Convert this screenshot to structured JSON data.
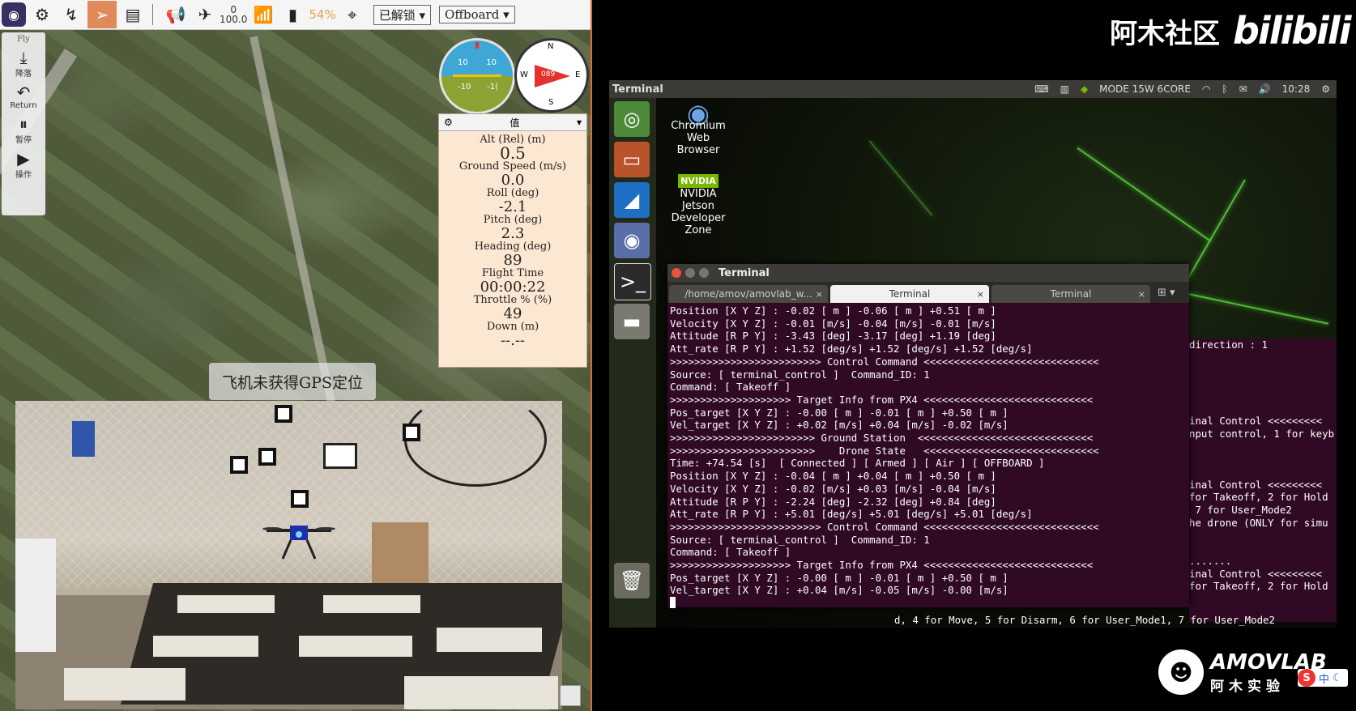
{
  "toolbar": {
    "counter_top": "0",
    "counter_bottom": "100.0",
    "battery": "54%",
    "arm_state": "已解锁",
    "flight_mode": "Offboard"
  },
  "fly_tools": {
    "heading": "Fly",
    "items": [
      {
        "label": "降落",
        "icon": "land-icon"
      },
      {
        "label": "Return",
        "icon": "return-icon"
      },
      {
        "label": "暂停",
        "icon": "pause-icon"
      },
      {
        "label": "操作",
        "icon": "action-icon"
      }
    ]
  },
  "attitude": {
    "pitch_top": "10",
    "pitch_top2": "10",
    "pitch_bottom": "-10",
    "pitch_bottom2": "-1("
  },
  "compass": {
    "n": "N",
    "e": "E",
    "s": "S",
    "w": "W",
    "heading": "089"
  },
  "values_panel": {
    "header": "值",
    "items": [
      {
        "label": "Alt (Rel) (m)",
        "value": "0.5"
      },
      {
        "label": "Ground Speed (m/s)",
        "value": "0.0"
      },
      {
        "label": "Roll (deg)",
        "value": "-2.1"
      },
      {
        "label": "Pitch (deg)",
        "value": "2.3"
      },
      {
        "label": "Heading (deg)",
        "value": "89"
      },
      {
        "label": "Flight Time",
        "value": "00:00:22"
      },
      {
        "label": "Throttle % (%)",
        "value": "49"
      },
      {
        "label": "Down (m)",
        "value": "--.--"
      }
    ]
  },
  "gps_message": "飞机未获得GPS定位",
  "watermark": {
    "site": "阿木社区",
    "brand": "bilibili"
  },
  "desktop": {
    "panel_title": "Terminal",
    "power_mode": "MODE 15W 6CORE",
    "clock": "10:28",
    "icons": [
      {
        "label": "Chromium Web Browser"
      },
      {
        "label": "NVIDIA Jetson Developer Zone",
        "badge": "NVIDIA"
      }
    ]
  },
  "terminal": {
    "title": "Terminal",
    "tabs": [
      {
        "label": "/home/amov/amovlab_w...",
        "active": false
      },
      {
        "label": "Terminal",
        "active": true
      },
      {
        "label": "Terminal",
        "active": false
      }
    ],
    "lines": [
      "Position [X Y Z] : -0.02 [ m ] -0.06 [ m ] +0.51 [ m ]",
      "Velocity [X Y Z] : -0.01 [m/s] -0.04 [m/s] -0.01 [m/s]",
      "Attitude [R P Y] : -3.43 [deg] -3.17 [deg] +1.19 [deg]",
      "Att_rate [R P Y] : +1.52 [deg/s] +1.52 [deg/s] +1.52 [deg/s]",
      ">>>>>>>>>>>>>>>>>>>>>>>>> Control Command <<<<<<<<<<<<<<<<<<<<<<<<<<<<<",
      "Source: [ terminal_control ]  Command_ID: 1",
      "Command: [ Takeoff ]",
      ">>>>>>>>>>>>>>>>>>>> Target Info from PX4 <<<<<<<<<<<<<<<<<<<<<<<<<<<<",
      "Pos_target [X Y Z] : -0.00 [ m ] -0.01 [ m ] +0.50 [ m ]",
      "Vel_target [X Y Z] : +0.02 [m/s] +0.04 [m/s] -0.02 [m/s]",
      ">>>>>>>>>>>>>>>>>>>>>>>> Ground Station  <<<<<<<<<<<<<<<<<<<<<<<<<<<<<",
      ">>>>>>>>>>>>>>>>>>>>>>>>    Drone State   <<<<<<<<<<<<<<<<<<<<<<<<<<<<<",
      "Time: +74.54 [s]  [ Connected ] [ Armed ] [ Air ] [ OFFBOARD ]",
      "Position [X Y Z] : -0.04 [ m ] +0.04 [ m ] +0.50 [ m ]",
      "Velocity [X Y Z] : -0.02 [m/s] +0.03 [m/s] -0.04 [m/s]",
      "Attitude [R P Y] : -2.24 [deg] -2.32 [deg] +0.84 [deg]",
      "Att_rate [R P Y] : +5.01 [deg/s] +5.01 [deg/s] +5.01 [deg/s]",
      ">>>>>>>>>>>>>>>>>>>>>>>>> Control Command <<<<<<<<<<<<<<<<<<<<<<<<<<<<<",
      "Source: [ terminal_control ]  Command_ID: 1",
      "Command: [ Takeoff ]",
      ">>>>>>>>>>>>>>>>>>>> Target Info from PX4 <<<<<<<<<<<<<<<<<<<<<<<<<<<<",
      "Pos_target [X Y Z] : -0.00 [ m ] -0.01 [ m ] +0.50 [ m ]",
      "Vel_target [X Y Z] : +0.04 [m/s] -0.05 [m/s] -0.00 [m/s]"
    ]
  },
  "bg_terminal": {
    "lines": [
      "direction : 1",
      "",
      "",
      "",
      "",
      "",
      "inal Control <<<<<<<<<",
      "nput control, 1 for keyb",
      "",
      "",
      "",
      "inal Control <<<<<<<<<",
      "for Takeoff, 2 for Hold",
      " 7 for User_Mode2",
      "he drone (ONLY for simu",
      "",
      "",
      ".......",
      "inal Control <<<<<<<<<",
      "for Takeoff, 2 for Hold"
    ],
    "footer": "d, 4 for Move, 5 for Disarm, 6 for User_Mode1, 7 for User_Mode2"
  },
  "amovlab": {
    "brand": "AMOVLAB",
    "sub": "阿木实验"
  },
  "ime": {
    "lang": "中"
  }
}
